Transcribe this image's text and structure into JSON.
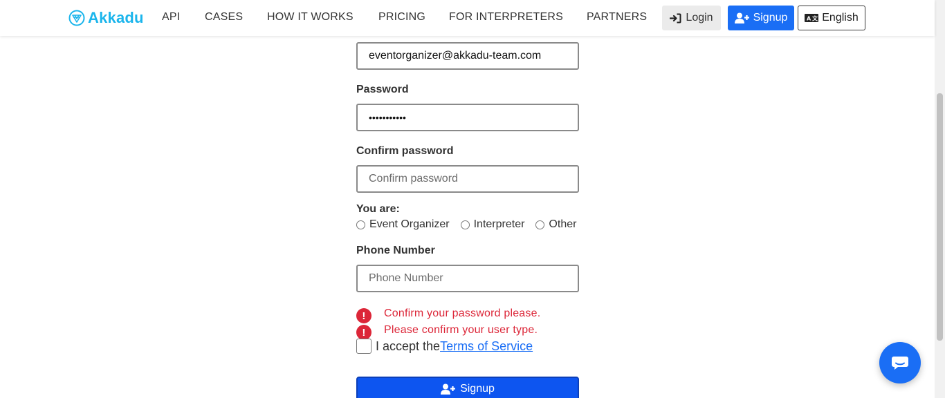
{
  "brand": {
    "name": "Akkadu",
    "color": "#1bb5ec"
  },
  "nav": {
    "links": [
      "API",
      "CASES",
      "HOW IT WORKS",
      "PRICING",
      "FOR INTERPRETERS",
      "PARTNERS"
    ],
    "login_label": "Login",
    "signup_label": "Signup",
    "language_label": "English"
  },
  "form": {
    "email": {
      "value": "eventorganizer@akkadu-team.com"
    },
    "password": {
      "label": "Password",
      "value": "•••••••••••"
    },
    "confirm_password": {
      "label": "Confirm password",
      "placeholder": "Confirm password",
      "value": ""
    },
    "user_type": {
      "label": "You are:",
      "options": [
        "Event Organizer",
        "Interpreter",
        "Other"
      ],
      "selected": null
    },
    "phone": {
      "label": "Phone Number",
      "placeholder": "Phone Number",
      "value": ""
    },
    "errors": [
      "Confirm your password please.",
      "Please confirm your user type."
    ],
    "terms": {
      "prefix": "I accept the",
      "link": "Terms of Service",
      "checked": false
    },
    "submit_label": "Signup"
  },
  "colors": {
    "primary": "#1a6ef5",
    "error": "#dc2638"
  },
  "icons": [
    "akkadu-logo-icon",
    "login-icon",
    "user-plus-icon",
    "translate-icon",
    "error-icon",
    "chat-icon"
  ]
}
